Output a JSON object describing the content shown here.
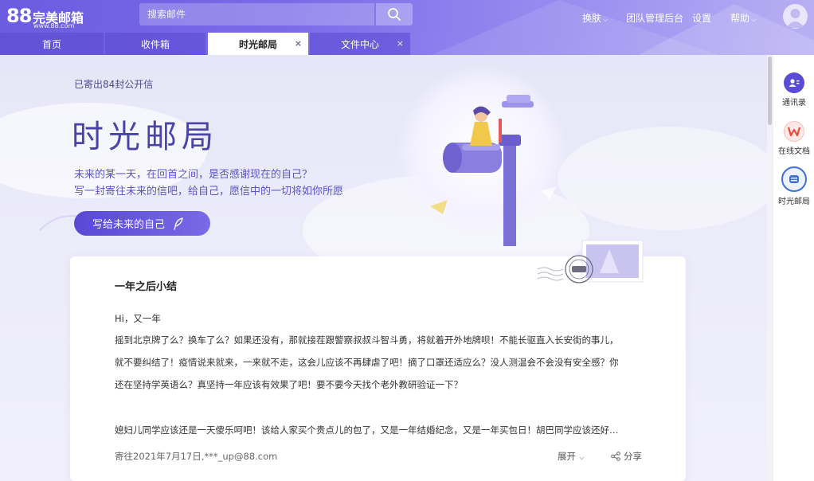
{
  "app": {
    "logo_number": "88",
    "logo_name": "完美邮箱",
    "logo_url": "www.88.com"
  },
  "search": {
    "placeholder": "搜索邮件"
  },
  "topnav": {
    "skin": "换肤",
    "team_admin": "团队管理后台",
    "settings": "设置",
    "help": "帮助"
  },
  "tabs": [
    {
      "label": "首页",
      "active": false
    },
    {
      "label": "收件箱",
      "active": false
    },
    {
      "label": "时光邮局",
      "active": true,
      "closable": true
    },
    {
      "label": "文件中心",
      "active": false,
      "closable": true
    }
  ],
  "tab_close_glyph": "×",
  "banner": {
    "sent_count": "已寄出84封公开信",
    "title": "时光邮局",
    "subtitle_line1": "未来的某一天，在回首之间，是否感谢现在的自己？",
    "subtitle_line2": "写一封寄往未来的信吧，给自己，愿信中的一切将如你所愿",
    "write_button": "写给未来的自己"
  },
  "letter": {
    "title": "一年之后小结",
    "greeting": "Hi，又一年",
    "lines": [
      "摇到北京牌了么？换车了么？如果还没有，那就接茬跟警察叔叔斗智斗勇，将就着开外地牌呗！不能长驱直入长安街的事儿，",
      "就不要纠结了！疫情说来就来，一来就不走，这会儿应该不再肆虐了吧！摘了口罩还适应么？没人测温会不会没有安全感？你",
      "还在坚持学英语么？真坚持一年应该有效果了吧！要不要今天找个老外教研验证一下？",
      "媳妇儿同学应该还是一天傻乐呵吧！该给人家买个贵点儿的包了，又是一年结婚纪念，又是一年买包日！胡巴同学应该还好…"
    ],
    "footer": "寄往2021年7月17日,***_up@88.com",
    "expand": "展开",
    "share": "分享"
  },
  "rail": [
    {
      "label": "通讯录",
      "icon": "contacts-icon",
      "color": "#5b4bd6"
    },
    {
      "label": "在线文档",
      "icon": "docs-icon",
      "color": "#e84c3d"
    },
    {
      "label": "时光邮局",
      "icon": "time-post-icon",
      "color": "#3f6fd8"
    }
  ],
  "colors": {
    "brand": "#6b5ce0",
    "title": "#4a44a8",
    "subtitle": "#5b55c8"
  }
}
